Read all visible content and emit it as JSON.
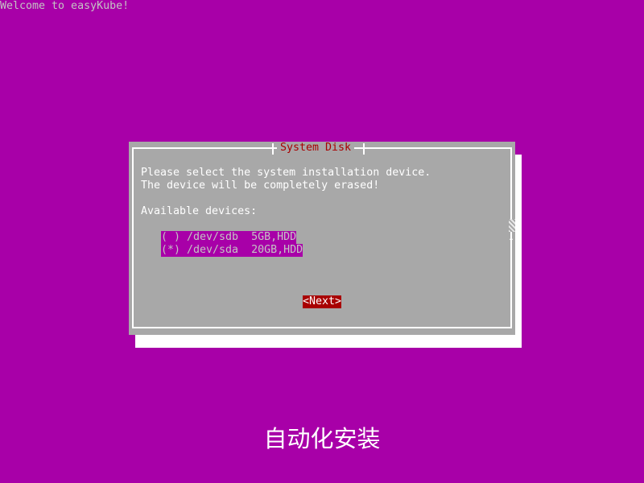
{
  "welcome": "Welcome to easyKube!",
  "dialog": {
    "title": "System Disk",
    "line1": "Please select the system installation device.",
    "line2": "The device will be completely erased!",
    "available_label": "Available devices:",
    "devices": [
      {
        "label": "( ) /dev/sdb  5GB,HDD",
        "selected": false
      },
      {
        "label": "(*) /dev/sda  20GB,HDD",
        "selected": true
      }
    ],
    "next_label": "<Next>",
    "scroll_arrow": "↓"
  },
  "caption": "自动化安装",
  "colors": {
    "background": "#a800a8",
    "dialog": "#a8a8a8",
    "title_text": "#a80000",
    "button": "#a80000"
  },
  "icons": {
    "scroll_arrow": "down-arrow-icon"
  }
}
